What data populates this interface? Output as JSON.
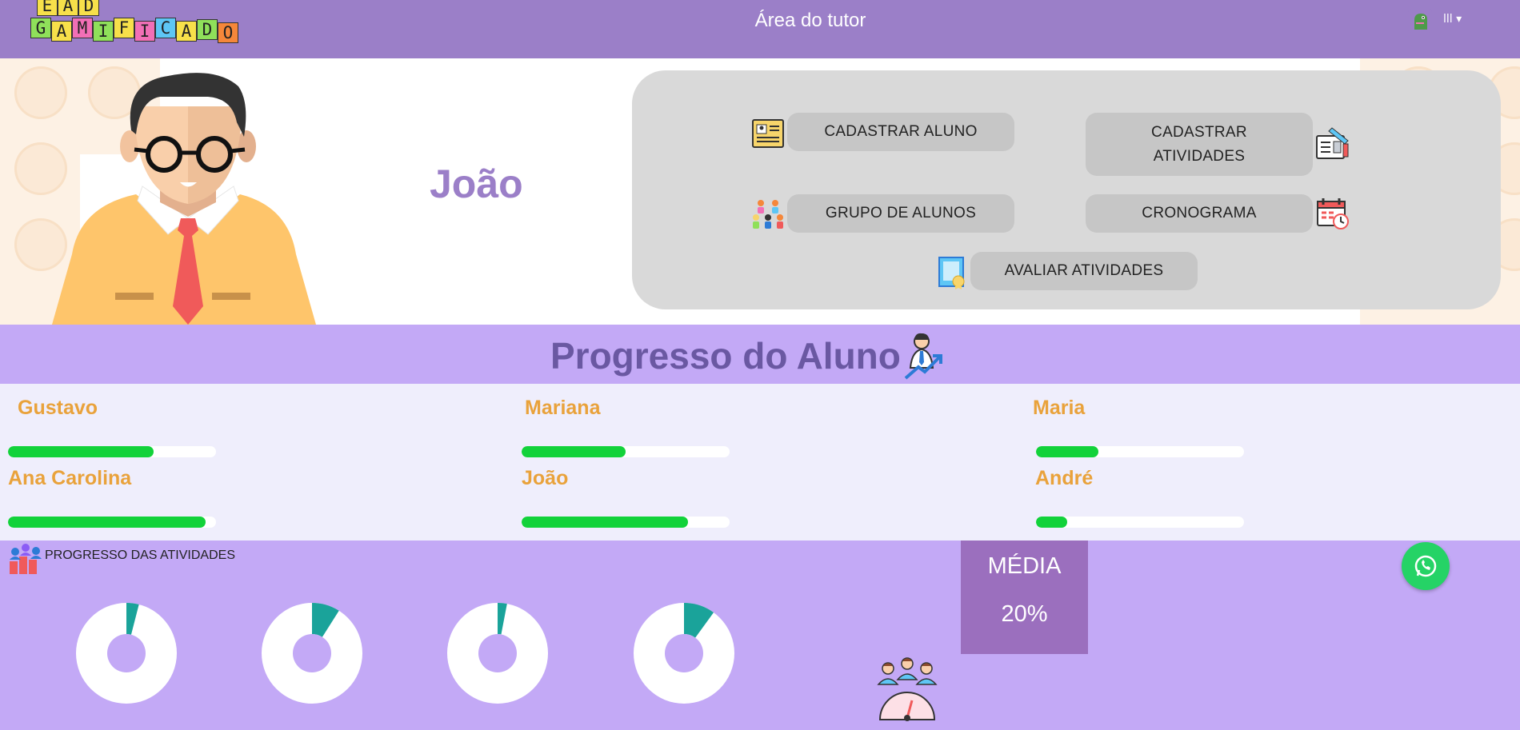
{
  "navbar": {
    "logo_letters_top": [
      "E",
      "A",
      "D"
    ],
    "logo_letters_bottom": [
      "G",
      "A",
      "M",
      "I",
      "F",
      "I",
      "C",
      "A",
      "D",
      "O"
    ],
    "title": "Área do tutor",
    "menu_label": "lll",
    "avatar_icon": "dinosaur-avatar-icon"
  },
  "tutor": {
    "name": "João",
    "figure": "teacher-illustration"
  },
  "actions": {
    "register_student": "CADASTRAR ALUNO",
    "register_activities_line1": "CADASTRAR",
    "register_activities_line2": "ATIVIDADES",
    "student_group": "GRUPO DE ALUNOS",
    "schedule": "CRONOGRAMA",
    "evaluate_activities": "AVALIAR ATIVIDADES"
  },
  "progress": {
    "title": "Progresso do Aluno",
    "students": [
      {
        "name": "Gustavo",
        "progress": 0.7
      },
      {
        "name": "Mariana",
        "progress": 0.5
      },
      {
        "name": "Maria",
        "progress": 0.3
      },
      {
        "name": "Ana Carolina",
        "progress": 0.95
      },
      {
        "name": "João",
        "progress": 0.8
      },
      {
        "name": "André",
        "progress": 0.15
      }
    ]
  },
  "activities": {
    "title": "PROGRESSO DAS ATIVIDADES",
    "donuts": [
      0.04,
      0.09,
      0.03,
      0.1
    ],
    "media_label": "MÉDIA",
    "media_value": "20%"
  },
  "colors": {
    "navbar": "#9b7fc8",
    "accent_name": "#e9a23b",
    "progress_fill": "#12d23a",
    "donut_fill": "#1aa39a",
    "media_box": "#9b6fbe",
    "whatsapp": "#25d366"
  }
}
